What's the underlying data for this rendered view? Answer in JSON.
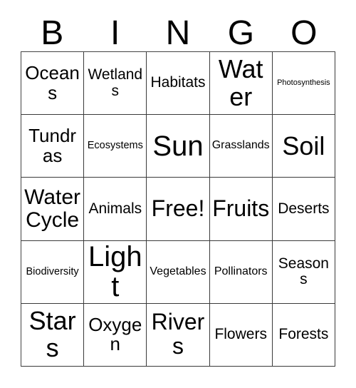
{
  "card": {
    "title": "BINGO",
    "header_letters": [
      "B",
      "I",
      "N",
      "G",
      "O"
    ],
    "background_color": "#ffffff",
    "border_color": "#3a3a3a",
    "text_color": "#000000",
    "columns": 5,
    "rows": 5,
    "free_space_label": "Free!",
    "free_space_position": "row3-col3",
    "cells": [
      [
        {
          "label": "Oceans",
          "size": "fs-md"
        },
        {
          "label": "Wetlands",
          "size": "fs-sm"
        },
        {
          "label": "Habitats",
          "size": "fs-sm"
        },
        {
          "label": "Water",
          "size": "fs-xl"
        },
        {
          "label": "Photosynthesis",
          "size": "fs-tiny"
        }
      ],
      [
        {
          "label": "Tundras",
          "size": "fs-md"
        },
        {
          "label": "Ecosystems",
          "size": "fs-xxs"
        },
        {
          "label": "Sun",
          "size": "fs-xxl"
        },
        {
          "label": "Grasslands",
          "size": "fs-xs"
        },
        {
          "label": "Soil",
          "size": "fs-xl"
        }
      ],
      [
        {
          "label": "Water Cycle",
          "size": "fs-mdl"
        },
        {
          "label": "Animals",
          "size": "fs-sm"
        },
        {
          "label": "Free!",
          "size": "fs-lg"
        },
        {
          "label": "Fruits",
          "size": "fs-lg"
        },
        {
          "label": "Deserts",
          "size": "fs-sm"
        }
      ],
      [
        {
          "label": "Biodiversity",
          "size": "fs-xxs"
        },
        {
          "label": "Light",
          "size": "fs-xxl"
        },
        {
          "label": "Vegetables",
          "size": "fs-xs"
        },
        {
          "label": "Pollinators",
          "size": "fs-xs"
        },
        {
          "label": "Seasons",
          "size": "fs-sm"
        }
      ],
      [
        {
          "label": "Stars",
          "size": "fs-xl"
        },
        {
          "label": "Oxygen",
          "size": "fs-md"
        },
        {
          "label": "Rivers",
          "size": "fs-lg"
        },
        {
          "label": "Flowers",
          "size": "fs-sm"
        },
        {
          "label": "Forests",
          "size": "fs-sm"
        }
      ]
    ]
  }
}
